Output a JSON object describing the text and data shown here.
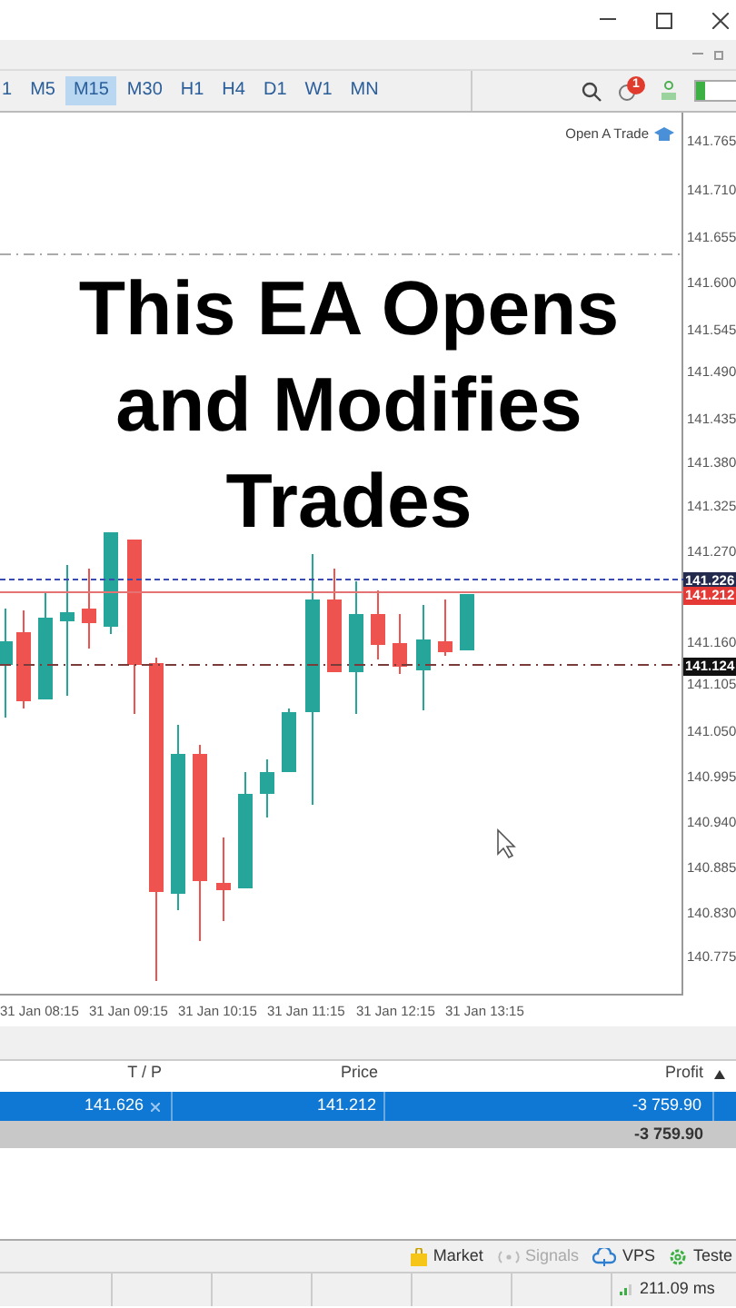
{
  "toolbar": {
    "timeframes": [
      {
        "label": "1",
        "selected": false
      },
      {
        "label": "M5",
        "selected": false
      },
      {
        "label": "M15",
        "selected": true
      },
      {
        "label": "M30",
        "selected": false
      },
      {
        "label": "H1",
        "selected": false
      },
      {
        "label": "H4",
        "selected": false
      },
      {
        "label": "D1",
        "selected": false
      },
      {
        "label": "W1",
        "selected": false
      },
      {
        "label": "MN",
        "selected": false
      }
    ],
    "notification_count": "1"
  },
  "chart": {
    "corner_label": "Open A Trade",
    "caption": "This EA Opens and Modifies Trades",
    "price_ticks": [
      "141.765",
      "141.710",
      "141.655",
      "141.600",
      "141.545",
      "141.490",
      "141.435",
      "141.380",
      "141.325",
      "141.270",
      "141.160",
      "141.105",
      "141.050",
      "140.995",
      "140.940",
      "140.885",
      "140.830",
      "140.775"
    ],
    "price_tags": [
      {
        "label": "141.226",
        "kind": "ask"
      },
      {
        "label": "141.212",
        "kind": "order"
      },
      {
        "label": "141.124",
        "kind": "bid"
      }
    ],
    "time_labels": [
      "31 Jan 08:15",
      "31 Jan 09:15",
      "31 Jan 10:15",
      "31 Jan 11:15",
      "31 Jan 12:15",
      "31 Jan 13:15"
    ]
  },
  "trades": {
    "columns": [
      "T / P",
      "Price",
      "Profit"
    ],
    "rows": [
      {
        "tp": "141.626",
        "price": "141.212",
        "profit": "-3 759.90",
        "selected": true
      }
    ],
    "total": "-3 759.90"
  },
  "bottom_tabs": [
    {
      "label": "Market",
      "kind": "market",
      "disabled": false
    },
    {
      "label": "Signals",
      "kind": "signals",
      "disabled": true
    },
    {
      "label": "VPS",
      "kind": "vps",
      "disabled": false
    },
    {
      "label": "Teste",
      "kind": "tester",
      "disabled": false
    }
  ],
  "status_bar": {
    "ping": "211.09 ms"
  }
}
